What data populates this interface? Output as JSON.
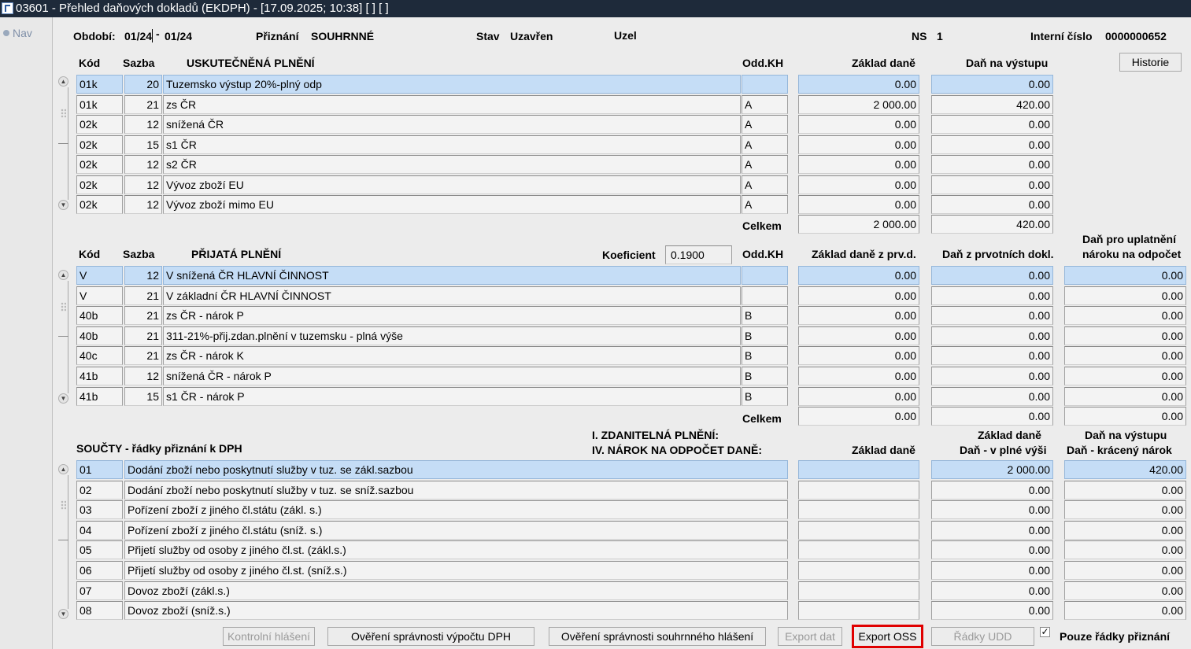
{
  "window": {
    "title": "03601 - Přehled daňových dokladů (EKDPH) - [17.09.2025; 10:38]  [ ]  [ ]"
  },
  "nav": {
    "label": "Nav"
  },
  "header": {
    "period_label": "Období:",
    "period_from": "01/24",
    "period_sep": "-",
    "period_to": "01/24",
    "return_label": "Přiznání",
    "return_value": "SOUHRNNÉ",
    "state_label": "Stav",
    "state_value": "Uzavřen",
    "node_label": "Uzel",
    "ns_label": "NS",
    "ns_value": "1",
    "internal_label": "Interní číslo",
    "internal_value": "0000000652",
    "history_button": "Historie"
  },
  "output": {
    "headers": {
      "code": "Kód",
      "rate": "Sazba",
      "title": "USKUTEČNĚNÁ PLNĚNÍ",
      "section": "Odd.KH",
      "base": "Základ daně",
      "tax": "Daň na výstupu"
    },
    "rows": [
      {
        "code": "01k",
        "rate": "20",
        "desc": "Tuzemsko výstup 20%-plný odp",
        "section": "",
        "base": "0.00",
        "tax": "0.00"
      },
      {
        "code": "01k",
        "rate": "21",
        "desc": "zs ČR",
        "section": "A",
        "base": "2 000.00",
        "tax": "420.00"
      },
      {
        "code": "02k",
        "rate": "12",
        "desc": "snížená ČR",
        "section": "A",
        "base": "0.00",
        "tax": "0.00"
      },
      {
        "code": "02k",
        "rate": "15",
        "desc": "s1 ČR",
        "section": "A",
        "base": "0.00",
        "tax": "0.00"
      },
      {
        "code": "02k",
        "rate": "12",
        "desc": "s2 ČR",
        "section": "A",
        "base": "0.00",
        "tax": "0.00"
      },
      {
        "code": "02k",
        "rate": "12",
        "desc": "Vývoz zboží EU",
        "section": "A",
        "base": "0.00",
        "tax": "0.00"
      },
      {
        "code": "02k",
        "rate": "12",
        "desc": "Vývoz zboží mimo EU",
        "section": "A",
        "base": "0.00",
        "tax": "0.00"
      }
    ],
    "total_label": "Celkem",
    "total_base": "2 000.00",
    "total_tax": "420.00"
  },
  "input": {
    "headers": {
      "code": "Kód",
      "rate": "Sazba",
      "title": "PŘIJATÁ PLNĚNÍ",
      "coef_label": "Koeficient",
      "coef_value": "0.1900",
      "section": "Odd.KH",
      "base": "Základ daně z prv.d.",
      "tax": "Daň z prvotních dokl.",
      "claim_1": "Daň pro uplatnění",
      "claim_2": "nároku na odpočet"
    },
    "rows": [
      {
        "code": "V",
        "rate": "12",
        "desc": "V snížená ČR HLAVNÍ ČINNOST",
        "section": "",
        "base": "0.00",
        "tax": "0.00",
        "claim": "0.00"
      },
      {
        "code": "V",
        "rate": "21",
        "desc": "V základní ČR HLAVNÍ ČINNOST",
        "section": "",
        "base": "0.00",
        "tax": "0.00",
        "claim": "0.00"
      },
      {
        "code": "40b",
        "rate": "21",
        "desc": "zs ČR - nárok P",
        "section": "B",
        "base": "0.00",
        "tax": "0.00",
        "claim": "0.00"
      },
      {
        "code": "40b",
        "rate": "21",
        "desc": "311-21%-přij.zdan.plnění v tuzemsku - plná výše",
        "section": "B",
        "base": "0.00",
        "tax": "0.00",
        "claim": "0.00"
      },
      {
        "code": "40c",
        "rate": "21",
        "desc": "zs ČR - nárok K",
        "section": "B",
        "base": "0.00",
        "tax": "0.00",
        "claim": "0.00"
      },
      {
        "code": "41b",
        "rate": "12",
        "desc": "snížená ČR - nárok P",
        "section": "B",
        "base": "0.00",
        "tax": "0.00",
        "claim": "0.00"
      },
      {
        "code": "41b",
        "rate": "15",
        "desc": "s1 ČR - nárok P",
        "section": "B",
        "base": "0.00",
        "tax": "0.00",
        "claim": "0.00"
      }
    ],
    "total_label": "Celkem",
    "total_base": "0.00",
    "total_tax": "0.00",
    "total_claim": "0.00"
  },
  "sums": {
    "headers": {
      "title": "SOUČTY - řádky přiznání k DPH",
      "part1": "I. ZDANITELNÁ PLNĚNÍ:",
      "part2": "IV. NÁROK NA ODPOČET DANĚ:",
      "base": "Základ daně",
      "col2_1": "Základ daně",
      "col2_2": "Daň - v plné výši",
      "col3_1": "Daň na výstupu",
      "col3_2": "Daň - krácený nárok"
    },
    "rows": [
      {
        "line": "01",
        "desc": "Dodání zboží nebo poskytnutí služby v tuz. se zákl.sazbou",
        "base": "",
        "full": "2 000.00",
        "reduced": "420.00"
      },
      {
        "line": "02",
        "desc": "Dodání zboží nebo poskytnutí služby v tuz. se sníž.sazbou",
        "base": "",
        "full": "0.00",
        "reduced": "0.00"
      },
      {
        "line": "03",
        "desc": "Pořízení zboží z jiného čl.státu (zákl. s.)",
        "base": "",
        "full": "0.00",
        "reduced": "0.00"
      },
      {
        "line": "04",
        "desc": "Pořízení zboží z jiného čl.státu (sníž. s.)",
        "base": "",
        "full": "0.00",
        "reduced": "0.00"
      },
      {
        "line": "05",
        "desc": "Přijetí služby od osoby z jiného čl.st. (zákl.s.)",
        "base": "",
        "full": "0.00",
        "reduced": "0.00"
      },
      {
        "line": "06",
        "desc": "Přijetí služby od osoby z jiného čl.st. (sníž.s.)",
        "base": "",
        "full": "0.00",
        "reduced": "0.00"
      },
      {
        "line": "07",
        "desc": "Dovoz zboží (zákl.s.)",
        "base": "",
        "full": "0.00",
        "reduced": "0.00"
      },
      {
        "line": "08",
        "desc": "Dovoz zboží (sníž.s.)",
        "base": "",
        "full": "0.00",
        "reduced": "0.00"
      }
    ]
  },
  "footer": {
    "control_report": "Kontrolní hlášení",
    "verify_vat": "Ověření správnosti výpočtu DPH",
    "verify_summary": "Ověření správnosti souhrnného hlášení",
    "export_data": "Export dat",
    "export_oss": "Export OSS",
    "udd_rows": "Řádky UDD",
    "only_lines_checked": "✓",
    "only_lines": "Pouze řádky přiznání"
  }
}
